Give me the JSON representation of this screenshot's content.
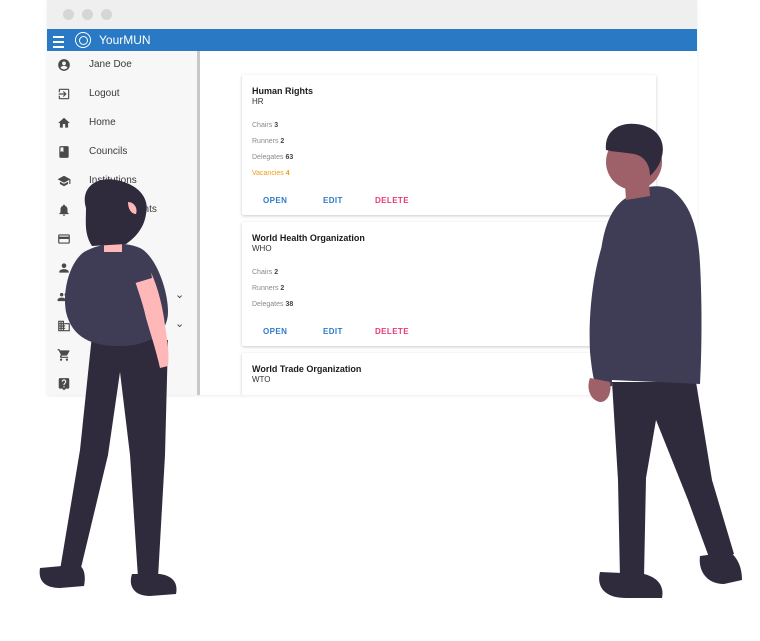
{
  "app": {
    "title": "YourMUN"
  },
  "sidebar": {
    "items": [
      {
        "label": "Jane Doe",
        "icon": "account-circle-icon"
      },
      {
        "label": "Logout",
        "icon": "logout-icon"
      },
      {
        "label": "Home",
        "icon": "home-icon"
      },
      {
        "label": "Councils",
        "icon": "book-icon"
      },
      {
        "label": "Institutions",
        "icon": "school-icon"
      },
      {
        "label": "Announcements",
        "icon": "bell-icon"
      },
      {
        "label": "",
        "icon": "credit-card-icon"
      },
      {
        "label": "",
        "icon": "person-icon"
      },
      {
        "label": "",
        "icon": "people-icon",
        "expandable": true
      },
      {
        "label": "",
        "icon": "building-icon",
        "expandable": true
      },
      {
        "label": "",
        "icon": "cart-icon"
      },
      {
        "label": "",
        "icon": "help-icon"
      }
    ],
    "visible_labels": {
      "jane": "Jane Doe",
      "logout": "Logout",
      "home": "Home",
      "councils": "Councils",
      "institutions": "Institutions",
      "announcements_partial": "ents"
    }
  },
  "councils": [
    {
      "name": "Human Rights",
      "code": "HR",
      "chairs_label": "Chairs",
      "chairs": "3",
      "runners_label": "Runners",
      "runners": "2",
      "delegates_label": "Delegates",
      "delegates": "63",
      "vacancies_label": "Vacancies",
      "vacancies": "4",
      "actions": {
        "open": "OPEN",
        "edit": "EDIT",
        "delete": "DELETE"
      }
    },
    {
      "name": "World Health Organization",
      "code": "WHO",
      "chairs_label": "Chairs",
      "chairs": "2",
      "runners_label": "Runners",
      "runners": "2",
      "delegates_label": "Delegates",
      "delegates": "38",
      "actions": {
        "open": "OPEN",
        "edit": "EDIT",
        "delete": "DELETE"
      }
    },
    {
      "name": "World Trade Organization",
      "code": "WTO"
    }
  ],
  "colors": {
    "appbar": "#2979c4",
    "action_primary": "#2d7cc8",
    "action_delete": "#e8387a",
    "vacancies": "#f39c12",
    "figure_dark": "#2f2b3d",
    "figure_shirt": "#3f3d56",
    "skin_light": "#ffb8b8",
    "skin_dark": "#9e616a"
  }
}
